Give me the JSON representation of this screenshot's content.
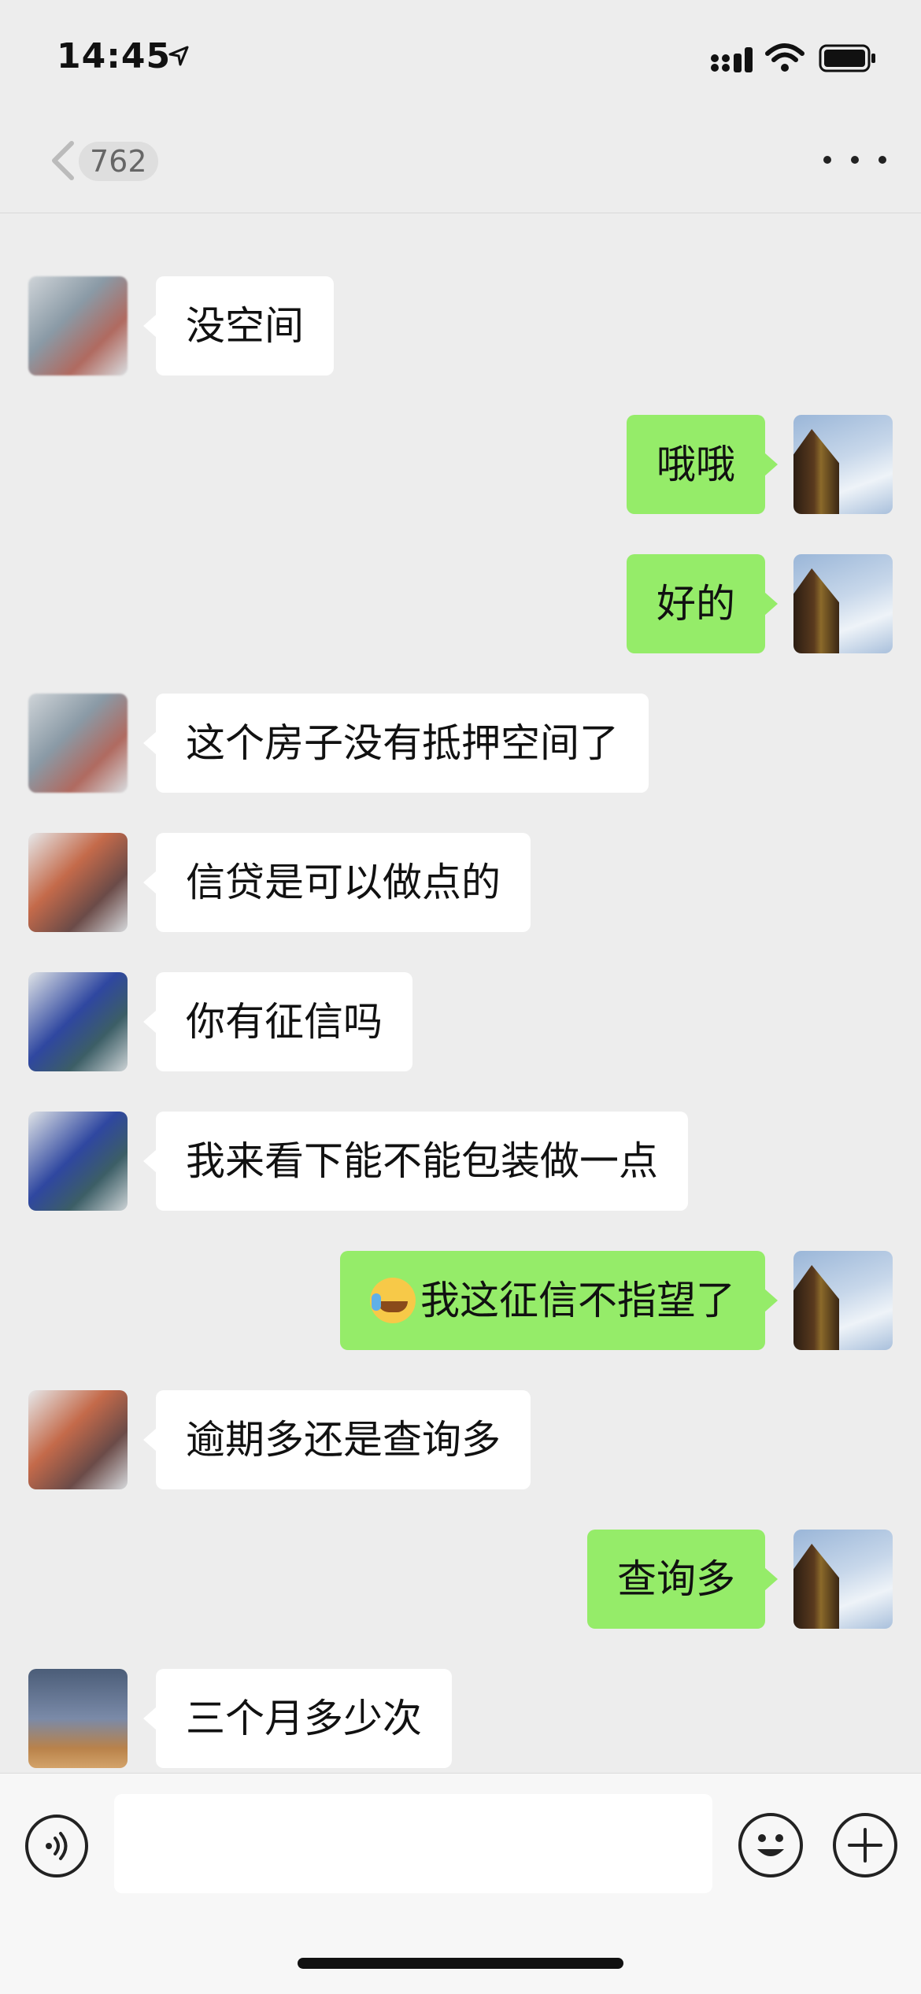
{
  "status_bar": {
    "time": "14:45",
    "icons": [
      "location-arrow-icon",
      "cellular-signal-icon",
      "wifi-icon",
      "battery-icon"
    ]
  },
  "nav": {
    "unread_count": "762",
    "back_icon": "chevron-left-icon",
    "more_icon": "more-dots-icon"
  },
  "colors": {
    "background": "#ededed",
    "self_bubble": "#95ec69",
    "other_bubble": "#ffffff",
    "input_bar": "#f7f7f7"
  },
  "messages": [
    {
      "side": "left",
      "text": "没空间"
    },
    {
      "side": "right",
      "text": "哦哦"
    },
    {
      "side": "right",
      "text": "好的"
    },
    {
      "side": "left",
      "text": "这个房子没有抵押空间了"
    },
    {
      "side": "left",
      "text": "信贷是可以做点的"
    },
    {
      "side": "left",
      "text": "你有征信吗"
    },
    {
      "side": "left",
      "text": "我来看下能不能包装做一点"
    },
    {
      "side": "right",
      "text": "我这征信不指望了",
      "emoji": "face-with-tears-icon"
    },
    {
      "side": "left",
      "text": "逾期多还是查询多"
    },
    {
      "side": "right",
      "text": "查询多"
    },
    {
      "side": "left",
      "text": "三个月多少次"
    }
  ],
  "input_bar": {
    "placeholder": "",
    "voice_icon": "voice-icon",
    "emoji_icon": "emoji-face-icon",
    "plus_icon": "plus-circle-icon"
  }
}
